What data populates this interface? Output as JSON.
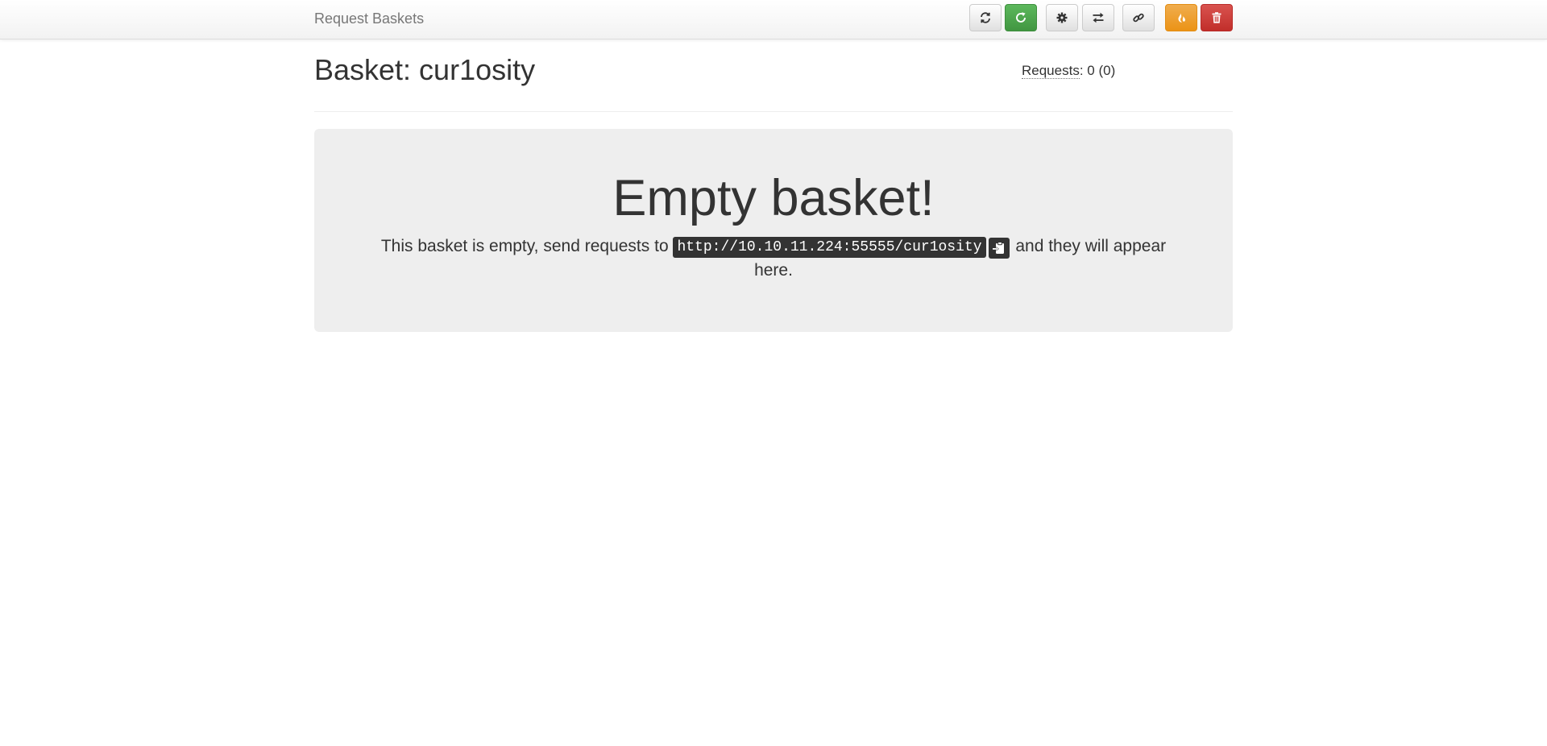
{
  "navbar": {
    "brand": "Request Baskets"
  },
  "toolbar": {
    "buttons": [
      {
        "name": "refresh-icon",
        "style": "default"
      },
      {
        "name": "auto-refresh-icon",
        "style": "success"
      },
      {
        "name": "gear-icon",
        "style": "default"
      },
      {
        "name": "transfer-icon",
        "style": "default"
      },
      {
        "name": "link-icon",
        "style": "default"
      },
      {
        "name": "fire-icon",
        "style": "warning"
      },
      {
        "name": "trash-icon",
        "style": "danger"
      }
    ]
  },
  "basket": {
    "title": "Basket: cur1osity",
    "requests_label": "Requests",
    "requests_value": ": 0 (0)"
  },
  "empty": {
    "heading": "Empty basket!",
    "text_before": "This basket is empty, send requests to ",
    "url": "http://10.10.11.224:55555/cur1osity",
    "text_after": " and they will appear here."
  },
  "colors": {
    "success": "#5cb85c",
    "warning": "#f0ad4e",
    "danger": "#d9534f",
    "jumbotron_bg": "#eeeeee",
    "code_bg": "#333333"
  }
}
